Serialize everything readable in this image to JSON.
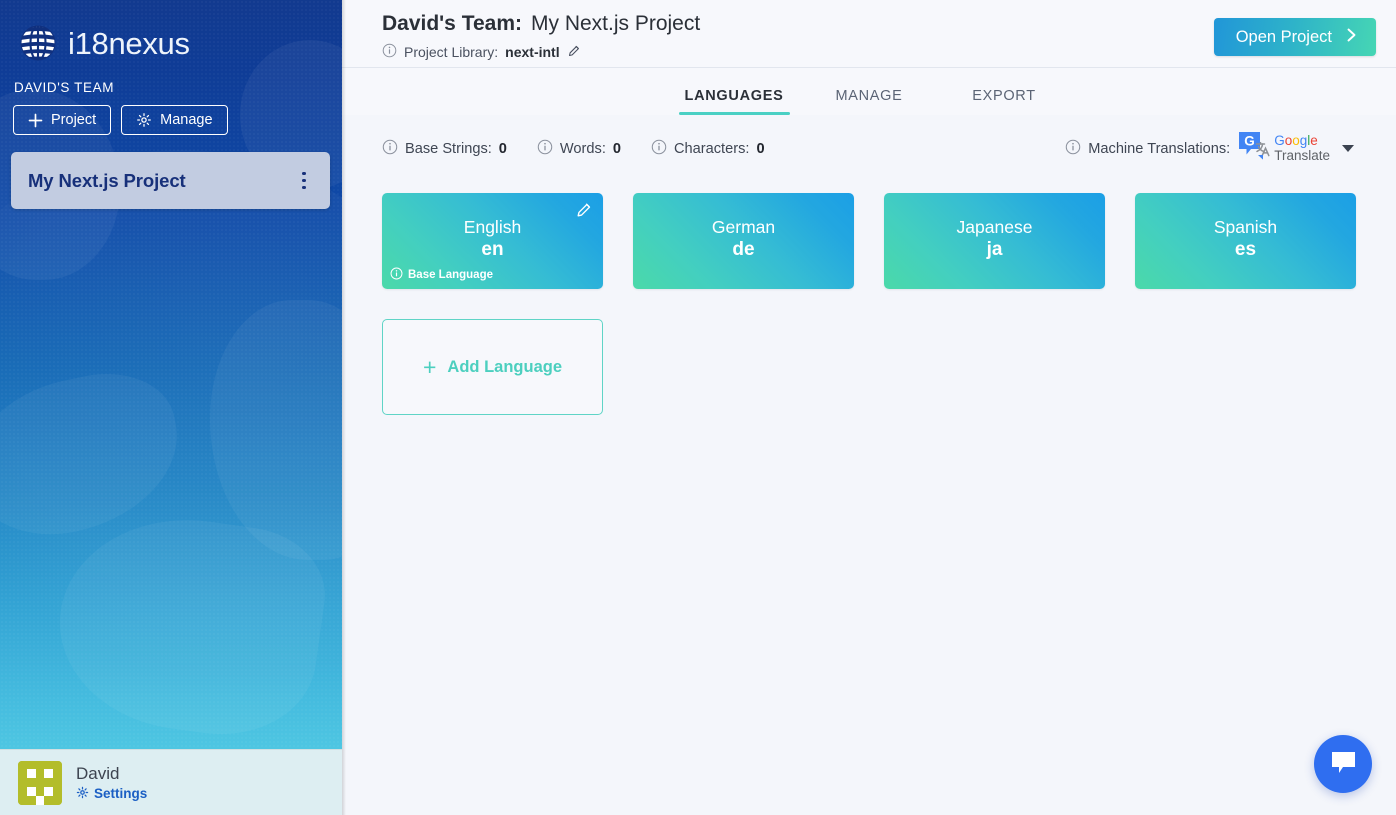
{
  "brand": {
    "name": "i18nexus",
    "logo_icon": "globe-icon"
  },
  "sidebar": {
    "team_label": "DAVID'S TEAM",
    "new_project_button": "Project",
    "manage_button": "Manage",
    "plus_icon": "plus-icon",
    "gear_icon": "gear-icon",
    "projects": [
      {
        "name": "My Next.js Project",
        "selected": true,
        "menu_icon": "kebab-menu-icon"
      }
    ],
    "footer": {
      "user_name": "David",
      "settings_label": "Settings",
      "settings_icon": "gear-icon",
      "avatar_icon": "identicon-avatar",
      "avatar_color": "#b3bd2a"
    }
  },
  "header": {
    "team_name": "David's Team:",
    "project_name": "My Next.js Project",
    "library_label": "Project Library:",
    "library_value": "next-intl",
    "library_info_icon": "info-icon",
    "library_edit_icon": "pencil-icon",
    "open_project_button": "Open Project",
    "open_project_chevron": "chevron-right-icon",
    "accent_gradient_from": "#2196d8",
    "accent_gradient_to": "#46d6b4"
  },
  "tabs": [
    {
      "label": "LANGUAGES",
      "active": true
    },
    {
      "label": "MANAGE",
      "active": false
    },
    {
      "label": "EXPORT",
      "active": false
    }
  ],
  "stats": [
    {
      "label": "Base Strings:",
      "value": "0",
      "info_icon": "info-icon"
    },
    {
      "label": "Words:",
      "value": "0",
      "info_icon": "info-icon"
    },
    {
      "label": "Characters:",
      "value": "0",
      "info_icon": "info-icon"
    }
  ],
  "machine_translations": {
    "label": "Machine Translations:",
    "info_icon": "info-icon",
    "provider": "Google Translate",
    "provider_logo_icon": "google-translate-icon",
    "google_word": [
      "G",
      "o",
      "o",
      "g",
      "l",
      "e"
    ],
    "translate_word": "Translate",
    "dropdown_icon": "chevron-down-icon"
  },
  "languages": [
    {
      "name": "English",
      "code": "en",
      "is_base": true,
      "base_badge": "Base Language",
      "edit_icon": "pencil-icon",
      "badge_info_icon": "info-icon"
    },
    {
      "name": "German",
      "code": "de",
      "is_base": false
    },
    {
      "name": "Japanese",
      "code": "ja",
      "is_base": false
    },
    {
      "name": "Spanish",
      "code": "es",
      "is_base": false
    }
  ],
  "add_language": {
    "label": "Add Language",
    "plus": "+",
    "accent": "#4ccfbf"
  },
  "chat_widget": {
    "icon": "chat-bubble-icon",
    "color": "#2f6ef0"
  }
}
